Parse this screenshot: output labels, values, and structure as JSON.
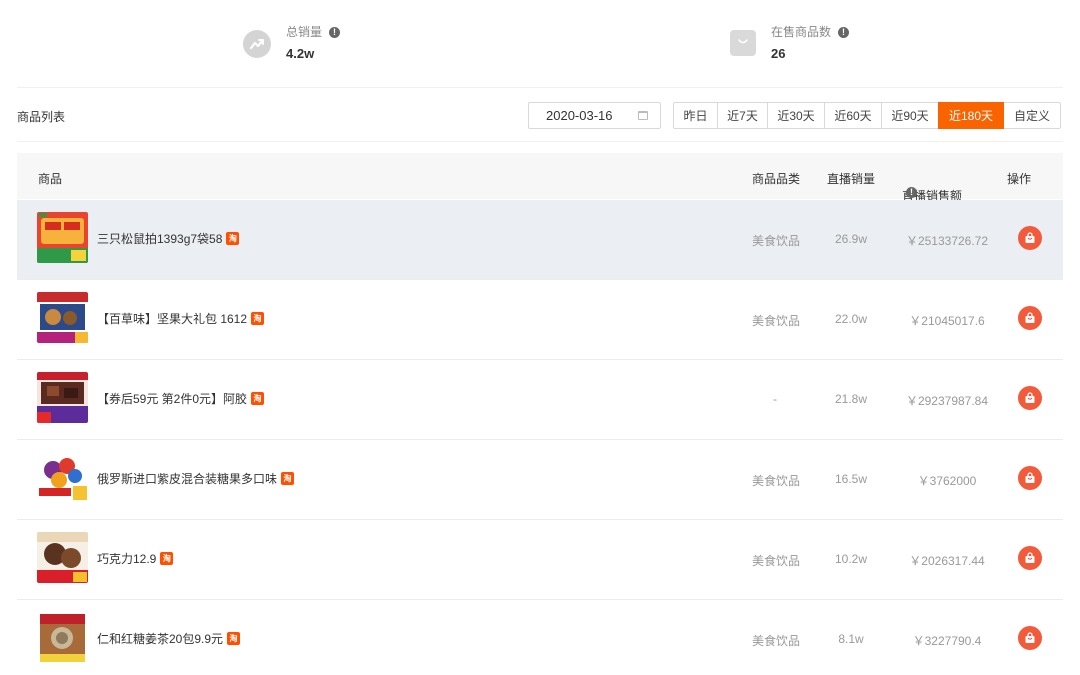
{
  "stats": {
    "total_sales": {
      "label": "总销量",
      "value": "4.2w",
      "icon": "trend-icon"
    },
    "goods_on_sale": {
      "label": "在售商品数",
      "value": "26",
      "icon": "shopping-bag-icon"
    }
  },
  "toolbar": {
    "title": "商品列表",
    "date": "2020-03-16",
    "ranges": [
      {
        "label": "昨日",
        "active": false
      },
      {
        "label": "近7天",
        "active": false
      },
      {
        "label": "近30天",
        "active": false
      },
      {
        "label": "近60天",
        "active": false
      },
      {
        "label": "近90天",
        "active": false
      },
      {
        "label": "近180天",
        "active": true
      },
      {
        "label": "自定义",
        "active": false
      }
    ]
  },
  "table": {
    "columns": {
      "goods": "商品",
      "category": "商品品类",
      "live_volume": "直播销量",
      "live_amount": "直播销售额",
      "action": "操作"
    },
    "rows": [
      {
        "name": "三只松鼠拍1393g7袋58",
        "category": "美食饮品",
        "volume": "26.9w",
        "amount": "￥25133726.72",
        "tag": "淘",
        "thumb": "thumb-1"
      },
      {
        "name": "【百草味】坚果大礼包 1612",
        "category": "美食饮品",
        "volume": "22.0w",
        "amount": "￥21045017.6",
        "tag": "淘",
        "thumb": "thumb-2"
      },
      {
        "name": "【券后59元 第2件0元】阿胶",
        "category": "-",
        "volume": "21.8w",
        "amount": "￥29237987.84",
        "tag": "淘",
        "thumb": "thumb-3"
      },
      {
        "name": "俄罗斯进口紫皮混合装糖果多口味",
        "category": "美食饮品",
        "volume": "16.5w",
        "amount": "￥3762000",
        "tag": "淘",
        "thumb": "thumb-4"
      },
      {
        "name": "巧克力12.9",
        "category": "美食饮品",
        "volume": "10.2w",
        "amount": "￥2026317.44",
        "tag": "淘",
        "thumb": "thumb-5"
      },
      {
        "name": "仁和红糖姜茶20包9.9元",
        "category": "美食饮品",
        "volume": "8.1w",
        "amount": "￥3227790.4",
        "tag": "淘",
        "thumb": "thumb-6"
      }
    ]
  },
  "colors": {
    "accent": "#fa6400",
    "shop_button": "#f25a3c",
    "highlight_row": "#ebeef3",
    "header_bg": "#f7f7f7"
  }
}
